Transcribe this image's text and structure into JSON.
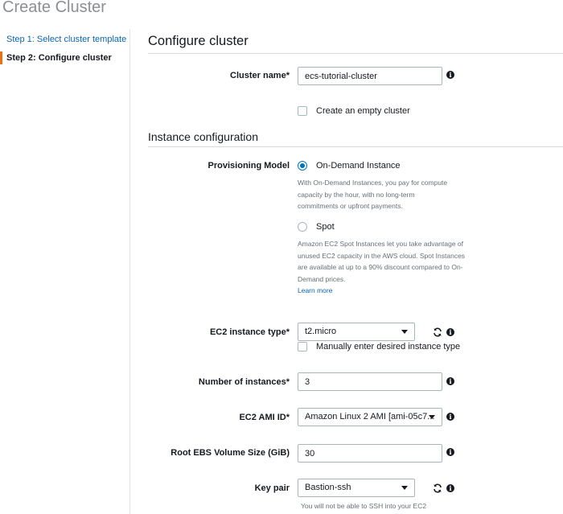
{
  "page": {
    "title": "Create Cluster"
  },
  "steps": [
    {
      "label": "Step 1: Select cluster template"
    },
    {
      "label": "Step 2: Configure cluster"
    }
  ],
  "sections": {
    "configure": "Configure cluster",
    "instance": "Instance configuration"
  },
  "cluster_name": {
    "label": "Cluster name*",
    "value": "ecs-tutorial-cluster"
  },
  "empty_cluster": {
    "label": "Create an empty cluster",
    "checked": false
  },
  "provisioning": {
    "label": "Provisioning Model",
    "on_demand": {
      "label": "On-Demand Instance",
      "selected": true,
      "help": "With On-Demand Instances, you pay for compute capacity by the hour, with no long-term commitments or upfront payments."
    },
    "spot": {
      "label": "Spot",
      "selected": false,
      "help": "Amazon EC2 Spot Instances let you take advantage of unused EC2 capacity in the AWS cloud. Spot Instances are available at up to a 90% discount compared to On-Demand prices.",
      "link": "Learn more"
    }
  },
  "instance_type": {
    "label": "EC2 instance type*",
    "value": "t2.micro",
    "manual_label": "Manually enter desired instance type"
  },
  "num_instances": {
    "label": "Number of instances*",
    "value": "3"
  },
  "ami": {
    "label": "EC2 AMI ID*",
    "value": "Amazon Linux 2 AMI [ami-05c7..."
  },
  "ebs": {
    "label": "Root EBS Volume Size (GiB)",
    "value": "30"
  },
  "key_pair": {
    "label": "Key pair",
    "value": "Bastion-ssh",
    "help": "You will not be able to SSH into your EC2"
  },
  "icons": {
    "info": "info-icon",
    "refresh": "refresh-icon",
    "dropdown": "chevron-down-icon"
  }
}
